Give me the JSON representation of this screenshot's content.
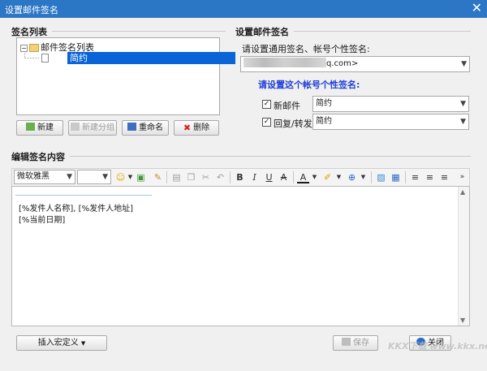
{
  "window": {
    "title": "设置邮件签名",
    "close_glyph": "✕"
  },
  "list_section": {
    "title": "签名列表",
    "tree_root": "邮件签名列表",
    "tree_selected": "简约"
  },
  "list_buttons": {
    "new": "新建",
    "new_group": "新建分组",
    "rename": "重命名",
    "delete": "删除"
  },
  "settings_section": {
    "title": "设置邮件签名",
    "prompt": "请设置通用签名、帐号个性签名:",
    "account_suffix": "q.com>",
    "account_prompt": "请设置这个帐号个性签名:",
    "new_mail_label": "新邮件",
    "new_mail_value": "简约",
    "reply_label": "回复/转发",
    "reply_value": "简约"
  },
  "editor_section": {
    "title": "编辑签名内容",
    "font_name": "微软雅黑",
    "line1": "[%发件人名称], [%发件人地址]",
    "line2": "[%当前日期]"
  },
  "footer": {
    "insert_macro": "插入宏定义",
    "save": "保存",
    "close": "关闭"
  },
  "watermark": "KKX下载 www.kkx.net"
}
